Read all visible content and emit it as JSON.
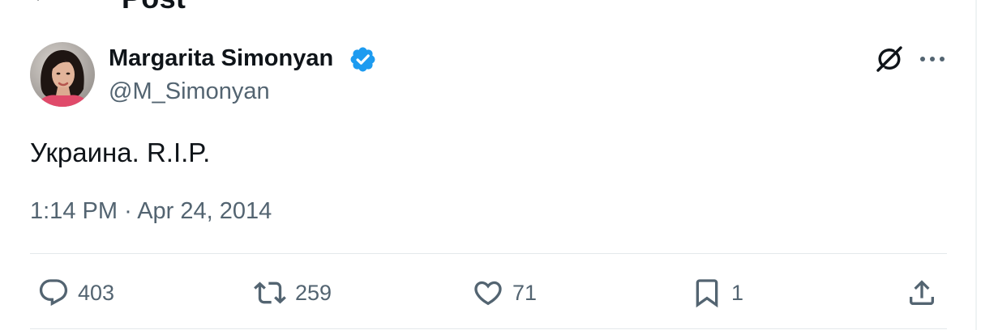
{
  "header": {
    "title": "Post",
    "back_icon": "arrow-left-icon"
  },
  "author": {
    "name": "Margarita Simonyan",
    "handle": "@M_Simonyan",
    "verified_color": "#1d9bf0"
  },
  "post": {
    "text": "Украина. R.I.P.",
    "time": "1:14 PM",
    "separator": "·",
    "date": "Apr 24, 2014"
  },
  "actions": {
    "replies": "403",
    "reposts": "259",
    "likes": "71",
    "bookmarks": "1",
    "icons": [
      "reply-icon",
      "repost-icon",
      "like-icon",
      "bookmark-icon",
      "share-icon"
    ]
  },
  "toolbar_icons": [
    "grok-icon",
    "more-icon"
  ],
  "colors": {
    "text": "#0f1419",
    "secondary": "#536471",
    "divider": "#e4e9eb",
    "accent": "#1d9bf0"
  }
}
